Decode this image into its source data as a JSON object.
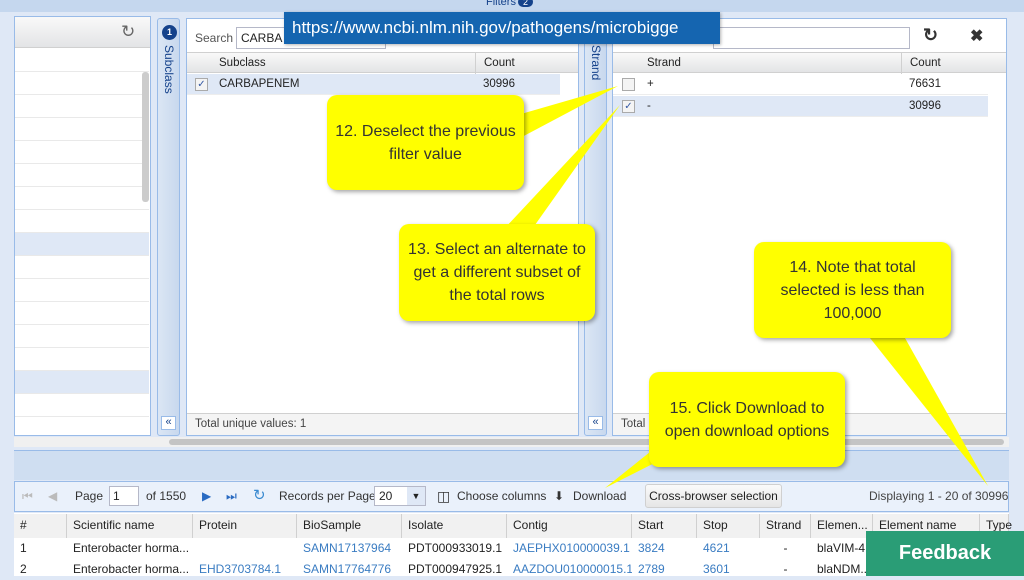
{
  "top": {
    "title": "Filters",
    "badge": "2"
  },
  "url_banner": "https://www.ncbi.nlm.nih.gov/pathogens/microbigge",
  "subclass_filter": {
    "tab_label": "Subclass",
    "tab_badge": "1",
    "search_label": "Search",
    "search_value": "CARBA",
    "columns": [
      "Subclass",
      "Count"
    ],
    "rows": [
      {
        "value": "CARBAPENEM",
        "count": "30996",
        "checked": true
      }
    ],
    "footer": "Total unique values: 1",
    "collapse": "«"
  },
  "strand_filter": {
    "tab_label": "Strand",
    "search_value": "",
    "columns": [
      "Strand",
      "Count"
    ],
    "rows": [
      {
        "value": "+",
        "count": "76631",
        "checked": false
      },
      {
        "value": "-",
        "count": "30996",
        "checked": true
      }
    ],
    "footer": "Total",
    "collapse": "«"
  },
  "callouts": [
    "12. Deselect the previous filter value",
    "13. Select an alternate to get a different subset of the total rows",
    "14. Note that total selected is less than 100,000",
    "15. Click Download to open download options"
  ],
  "toolbar": {
    "page_label": "Page",
    "page_value": "1",
    "of_pages": "of 1550",
    "records_label": "Records per Page",
    "records_value": "20",
    "choose_columns": "Choose columns",
    "download": "Download",
    "cross_browser": "Cross-browser selection",
    "displaying": "Displaying 1 - 20 of 30996"
  },
  "table": {
    "columns": [
      "#",
      "Scientific name",
      "Protein",
      "BioSample",
      "Isolate",
      "Contig",
      "Start",
      "Stop",
      "Strand",
      "Elemen...",
      "Element name",
      "Type"
    ],
    "rows": [
      [
        "1",
        "Enterobacter horma...",
        "",
        "SAMN17137964",
        "PDT000933019.1",
        "JAEPHX010000039.1",
        "3824",
        "4621",
        "-",
        "blaVIM-4",
        "",
        ""
      ],
      [
        "2",
        "Enterobacter horma...",
        "EHD3703784.1",
        "SAMN17764776",
        "PDT000947925.1",
        "AAZDOU010000015.1",
        "2789",
        "3601",
        "-",
        "blaNDM...",
        "",
        ""
      ]
    ]
  },
  "feedback": "Feedback",
  "colors": {
    "accent": "#15428b",
    "banner": "#1565b0",
    "callout": "#ffff00",
    "feedback": "#2a9d76"
  }
}
